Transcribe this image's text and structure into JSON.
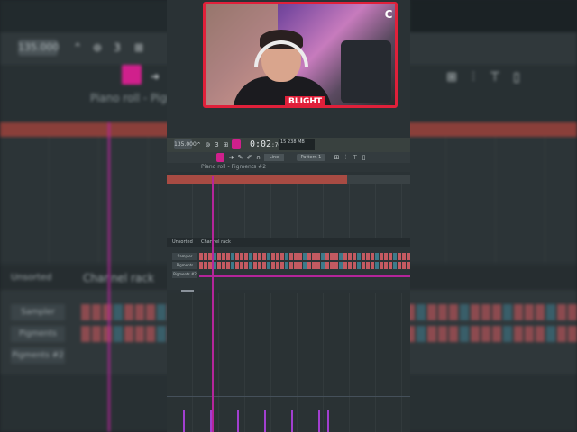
{
  "transport": {
    "tempo": "135.000",
    "time": "0:02",
    "time_sub": ":70",
    "meter_top": "15",
    "meter_right": "238 MB",
    "pattern": "Pattern 1",
    "line_mode": "Line"
  },
  "piano_roll": {
    "title": "Piano roll - Pigments #2",
    "bg_title": "Piano roll - Pigm"
  },
  "channel_rack": {
    "filter": "Unsorted",
    "title": "Channel rack",
    "channels": [
      {
        "name": "Sampler"
      },
      {
        "name": "Pigments"
      },
      {
        "name": "Pigments #2"
      }
    ]
  },
  "webcam": {
    "brand": "BLIGHT",
    "logo": "C"
  },
  "colors": {
    "accent": "#d0208c",
    "webcam_border": "#e0203a",
    "playhead": "#b4259a",
    "step_red": "#c45a61",
    "step_teal": "#3d7a8a"
  }
}
